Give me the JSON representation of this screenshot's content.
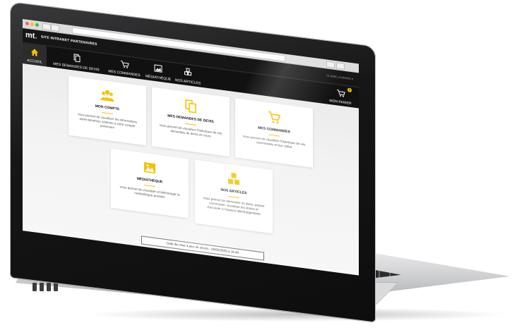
{
  "browser": {
    "title": "SITE INTRANET PARTENAIRES"
  },
  "header": {
    "logo": "mt",
    "site_title": "SITE INTRANET PARTENAIRES",
    "user_link": "CLAIRE LAURANS ▾"
  },
  "nav": {
    "items": [
      {
        "label": "ACCUEIL",
        "icon": "home-icon"
      },
      {
        "label": "MES DEMANDES DE DEVIS",
        "icon": "documents-icon"
      },
      {
        "label": "MES COMMANDES",
        "icon": "cart-icon"
      },
      {
        "label": "MÉDIATHÈQUE",
        "icon": "image-icon"
      },
      {
        "label": "NOS ARTICLES",
        "icon": "boxes-icon"
      }
    ],
    "basket": {
      "label": "MON PANIER",
      "count": "0",
      "icon": "cart-icon"
    }
  },
  "cards": [
    {
      "title": "MON COMPTE",
      "desc": "Vous permet de visualiser les informations administratives relatives à votre compte partenaire",
      "icon": "users-icon"
    },
    {
      "title": "MES DEMANDES DE DEVIS",
      "desc": "Vous permet de visualiser l'historique de vos demandes de devis en cours",
      "icon": "documents-icon"
    },
    {
      "title": "MES COMMANDES",
      "desc": "Vous permet de visualiser l'historique de vos commandes et leur statut",
      "icon": "cart-icon"
    },
    {
      "title": "MÉDIATHÈQUE",
      "desc": "Vous permet de visualiser et télécharger la médiathèque produits",
      "icon": "image-icon"
    },
    {
      "title": "NOS ARTICLES",
      "desc": "Vous permet de demander un devis, passer commande, visualiser les stocks et d'accéder à l'espace téléchargements",
      "icon": "boxes-icon"
    }
  ],
  "update": "Date de mise à jour de stocks : 05/05/2020 à 16:46",
  "colors": {
    "accent": "#f5c200",
    "header": "#161616",
    "nav": "#111111"
  }
}
